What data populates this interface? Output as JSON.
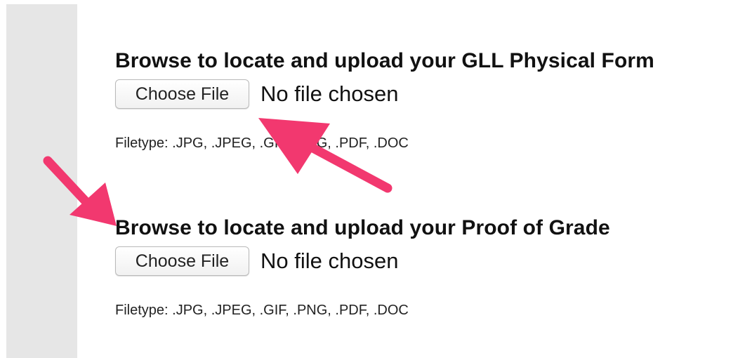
{
  "uploads": [
    {
      "heading": "Browse to locate and upload your GLL Physical Form",
      "button_label": "Choose File",
      "status": "No file chosen",
      "filetype": "Filetype: .JPG, .JPEG, .GIF, .PNG, .PDF, .DOC"
    },
    {
      "heading": "Browse to locate and upload your Proof of Grade",
      "button_label": "Choose File",
      "status": "No file chosen",
      "filetype": "Filetype: .JPG, .JPEG, .GIF, .PNG, .PDF, .DOC"
    }
  ],
  "colors": {
    "arrow": "#f2386f",
    "gutter": "#e6e6e6"
  }
}
